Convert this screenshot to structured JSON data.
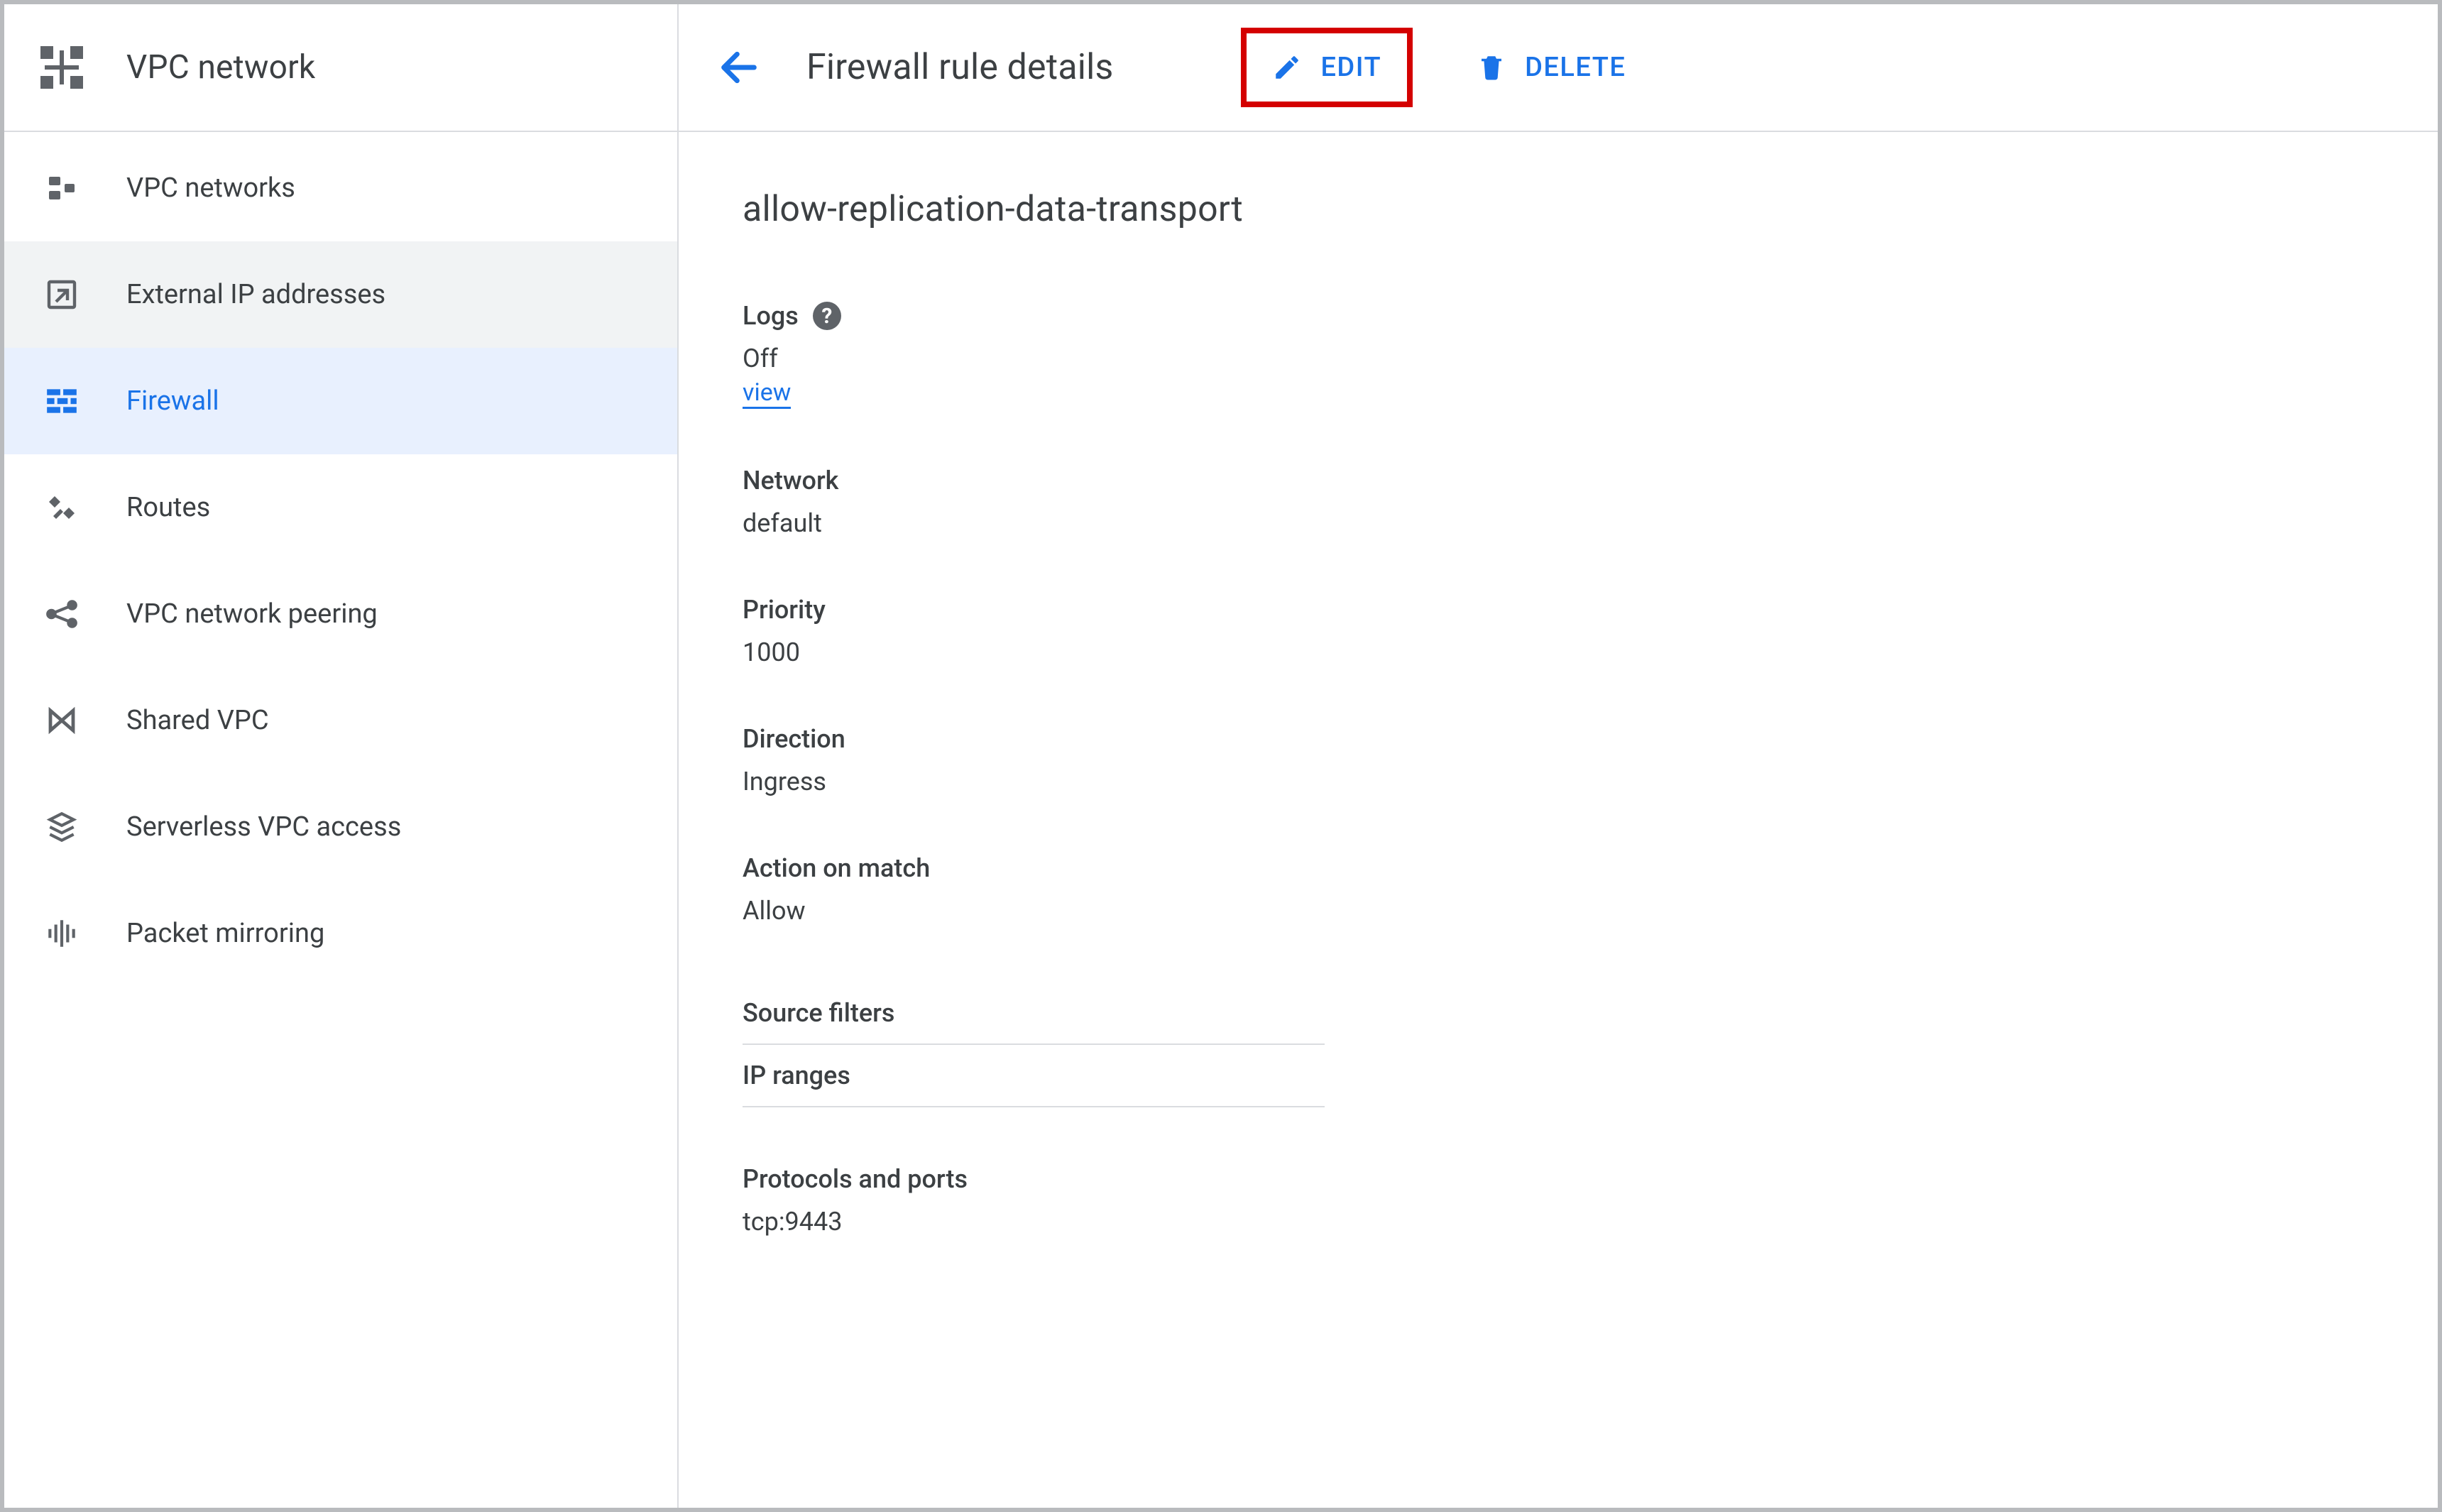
{
  "product": {
    "title": "VPC network"
  },
  "sidebar": {
    "items": [
      {
        "label": "VPC networks",
        "icon": "networks"
      },
      {
        "label": "External IP addresses",
        "icon": "external-ip"
      },
      {
        "label": "Firewall",
        "icon": "firewall"
      },
      {
        "label": "Routes",
        "icon": "routes"
      },
      {
        "label": "VPC network peering",
        "icon": "peering"
      },
      {
        "label": "Shared VPC",
        "icon": "shared-vpc"
      },
      {
        "label": "Serverless VPC access",
        "icon": "serverless"
      },
      {
        "label": "Packet mirroring",
        "icon": "mirroring"
      }
    ]
  },
  "topbar": {
    "page_title": "Firewall rule details",
    "edit_label": "EDIT",
    "delete_label": "DELETE"
  },
  "rule": {
    "name": "allow-replication-data-transport",
    "logs": {
      "label": "Logs",
      "value": "Off",
      "view_link": "view"
    },
    "network": {
      "label": "Network",
      "value": "default"
    },
    "priority": {
      "label": "Priority",
      "value": "1000"
    },
    "direction": {
      "label": "Direction",
      "value": "Ingress"
    },
    "action": {
      "label": "Action on match",
      "value": "Allow"
    },
    "source_filters": {
      "label": "Source filters",
      "ip_ranges_label": "IP ranges"
    },
    "protocols_ports": {
      "label": "Protocols and ports",
      "value": "tcp:9443"
    }
  }
}
